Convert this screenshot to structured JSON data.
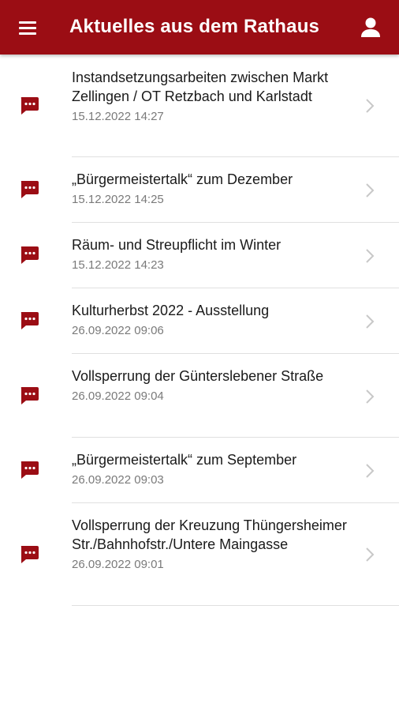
{
  "appbar": {
    "title": "Aktuelles aus dem Rathaus",
    "menu_icon": "hamburger-menu-icon",
    "profile_icon": "person-icon",
    "background_color": "#9b0d14"
  },
  "news": [
    {
      "title": "Instandsetzungsarbeiten zwischen Markt Zellingen / OT Retzbach und Karlstadt",
      "date": "15.12.2022 14:27"
    },
    {
      "title": "„Bürgermeistertalk“ zum Dezember",
      "date": "15.12.2022 14:25"
    },
    {
      "title": "Räum- und Streupflicht im Winter",
      "date": "15.12.2022 14:23"
    },
    {
      "title": "Kulturherbst 2022 - Ausstellung",
      "date": "26.09.2022 09:06"
    },
    {
      "title": "Vollsperrung der Günterslebener Straße",
      "date": "26.09.2022 09:04"
    },
    {
      "title": "„Bürgermeistertalk“ zum September",
      "date": "26.09.2022 09:03"
    },
    {
      "title": "Vollsperrung der Kreuzung Thüngersheimer Str./Bahnhofstr./Untere Maingasse",
      "date": "26.09.2022 09:01"
    }
  ],
  "item_icon": "chat-message-icon",
  "item_icon_color": "#9b0d14"
}
